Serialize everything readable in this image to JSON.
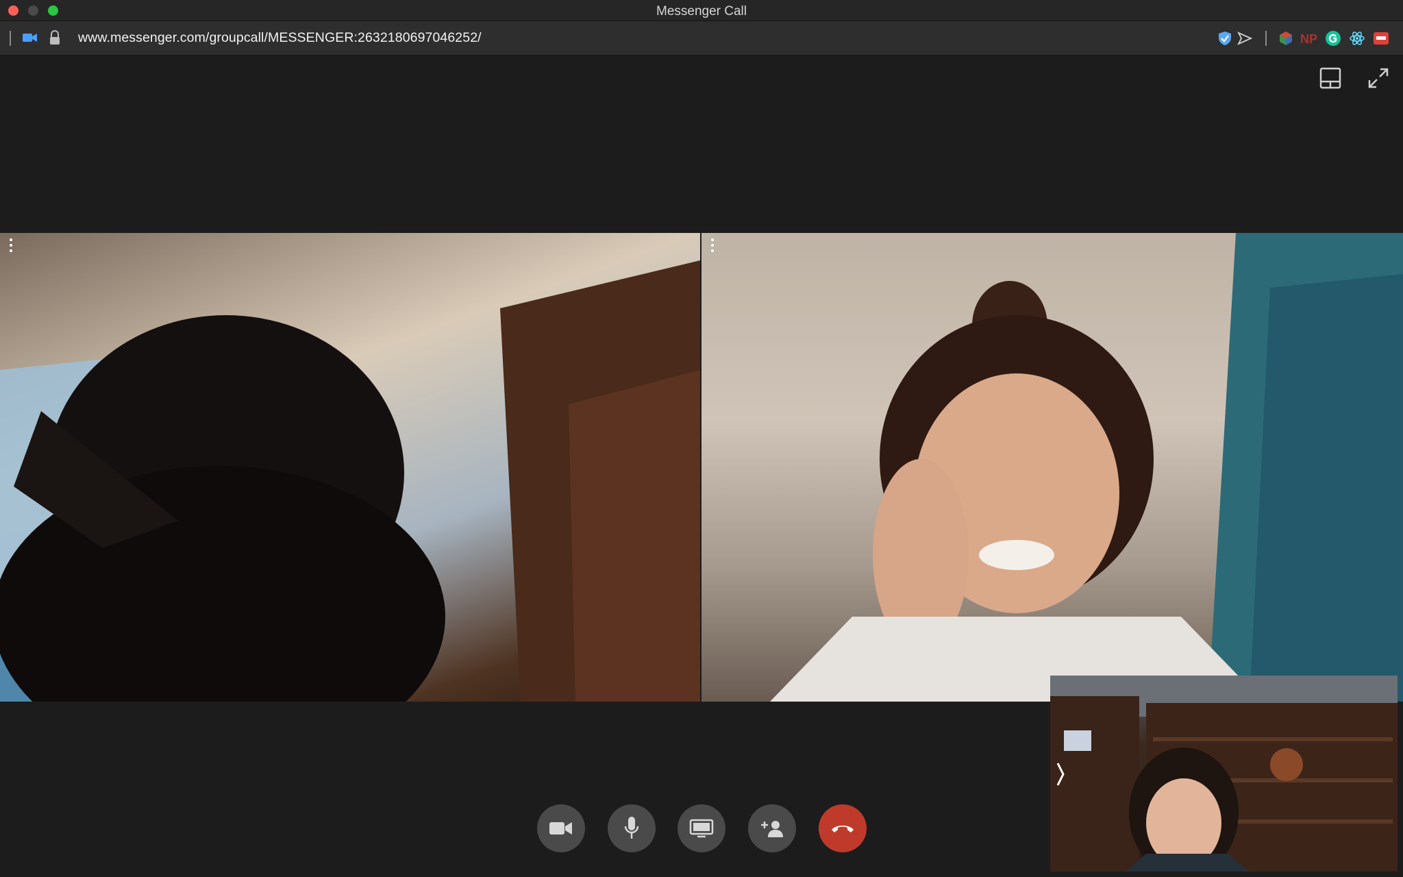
{
  "window": {
    "title": "Messenger Call"
  },
  "addressbar": {
    "url": "www.messenger.com/groupcall/MESSENGER:2632180697046252/"
  },
  "call": {
    "participants": [
      {
        "tile": "remote-left"
      },
      {
        "tile": "remote-right"
      }
    ],
    "self_view": {
      "visible": true
    }
  },
  "controls": [
    {
      "name": "video-toggle",
      "icon": "video-camera-icon"
    },
    {
      "name": "mic-toggle",
      "icon": "microphone-icon"
    },
    {
      "name": "screen-share",
      "icon": "monitor-icon"
    },
    {
      "name": "add-person",
      "icon": "add-person-icon"
    },
    {
      "name": "end-call",
      "icon": "hang-up-icon"
    }
  ],
  "colors": {
    "end_call": "#c03a2b",
    "control_bg": "#4a4a4a",
    "stage_bg": "#1c1c1c"
  },
  "extensions": [
    "shield-check-icon",
    "send-icon",
    "cube-icon",
    "np-icon",
    "grammarly-icon",
    "react-icon",
    "red-tag-icon"
  ]
}
